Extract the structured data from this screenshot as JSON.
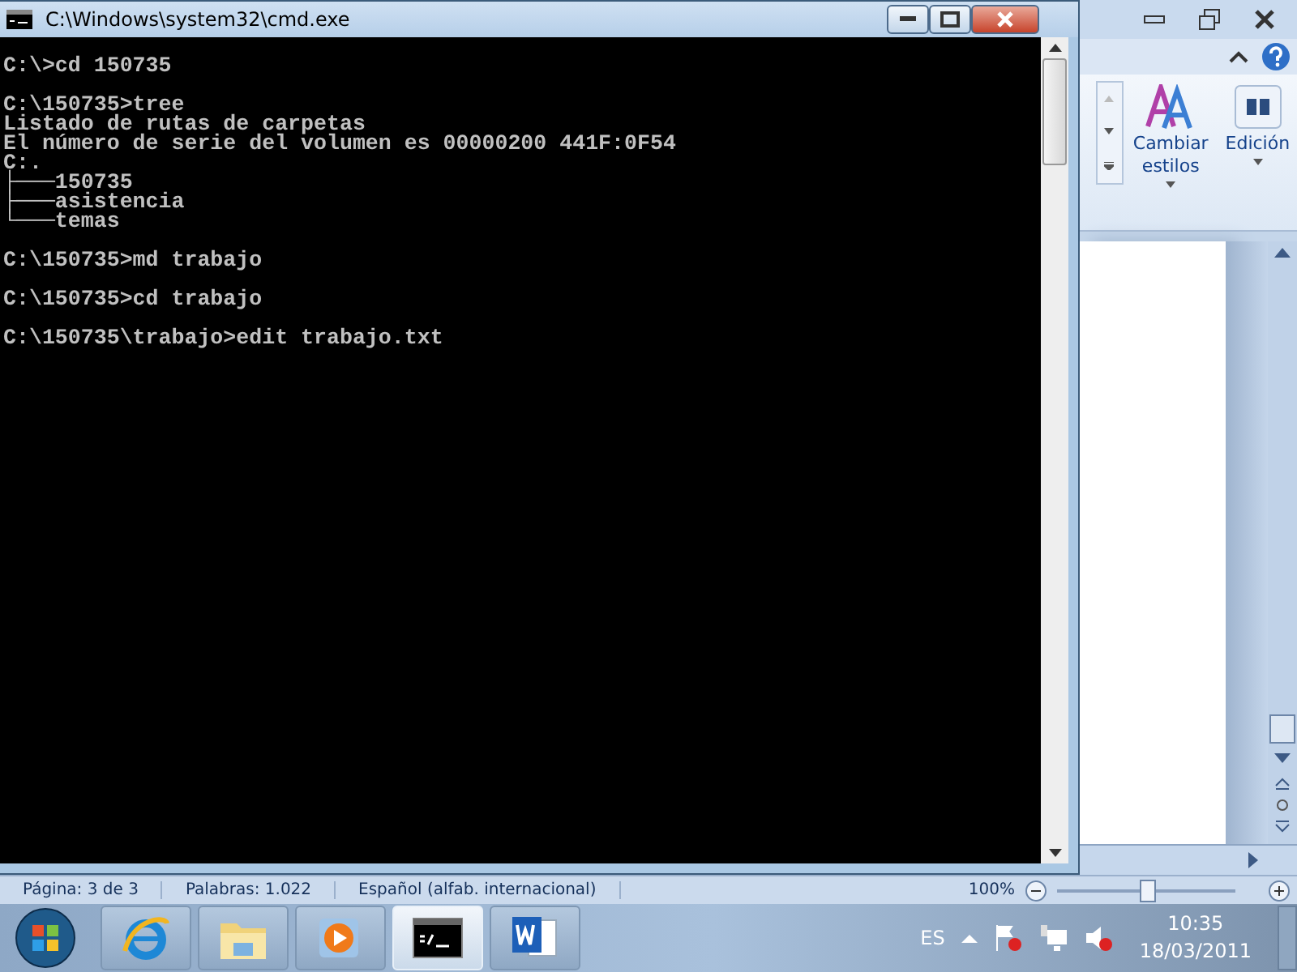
{
  "console_window": {
    "title": "C:\\Windows\\system32\\cmd.exe",
    "lines": [
      {
        "text": "C:\\>cd 150735",
        "blank_before": true
      },
      {
        "text": "C:\\150735>tree",
        "blank_before": true
      },
      {
        "text": "Listado de rutas de carpetas",
        "blank_before": false
      },
      {
        "text": "El número de serie del volumen es 00000200 441F:0F54",
        "blank_before": false
      },
      {
        "text": "C:.",
        "blank_before": false
      },
      {
        "text": "├───150735",
        "blank_before": false
      },
      {
        "text": "├───asistencia",
        "blank_before": false
      },
      {
        "text": "└───temas",
        "blank_before": false
      },
      {
        "text": "C:\\150735>md trabajo",
        "blank_before": true
      },
      {
        "text": "C:\\150735>cd trabajo",
        "blank_before": true
      },
      {
        "text": "C:\\150735\\trabajo>edit trabajo.txt",
        "blank_before": true
      }
    ]
  },
  "word_window": {
    "ribbon_buttons": [
      {
        "kind": "styles",
        "label": "Cambiar estilos"
      },
      {
        "kind": "find",
        "label": "Edición"
      }
    ],
    "status_bar": {
      "items": [
        "Página: 3 de 3",
        "Palabras: 1.022",
        "Español (alfab. internacional)"
      ],
      "zoom": "100%",
      "level": 0.5
    }
  },
  "taskbar": {
    "apps": [
      {
        "kind": "browser",
        "selected": false
      },
      {
        "kind": "folder",
        "selected": false
      },
      {
        "kind": "media",
        "selected": false
      },
      {
        "kind": "console",
        "selected": true
      },
      {
        "kind": "word",
        "selected": false
      }
    ],
    "language": "ES",
    "time": "10:35",
    "date": "18/03/2011"
  }
}
